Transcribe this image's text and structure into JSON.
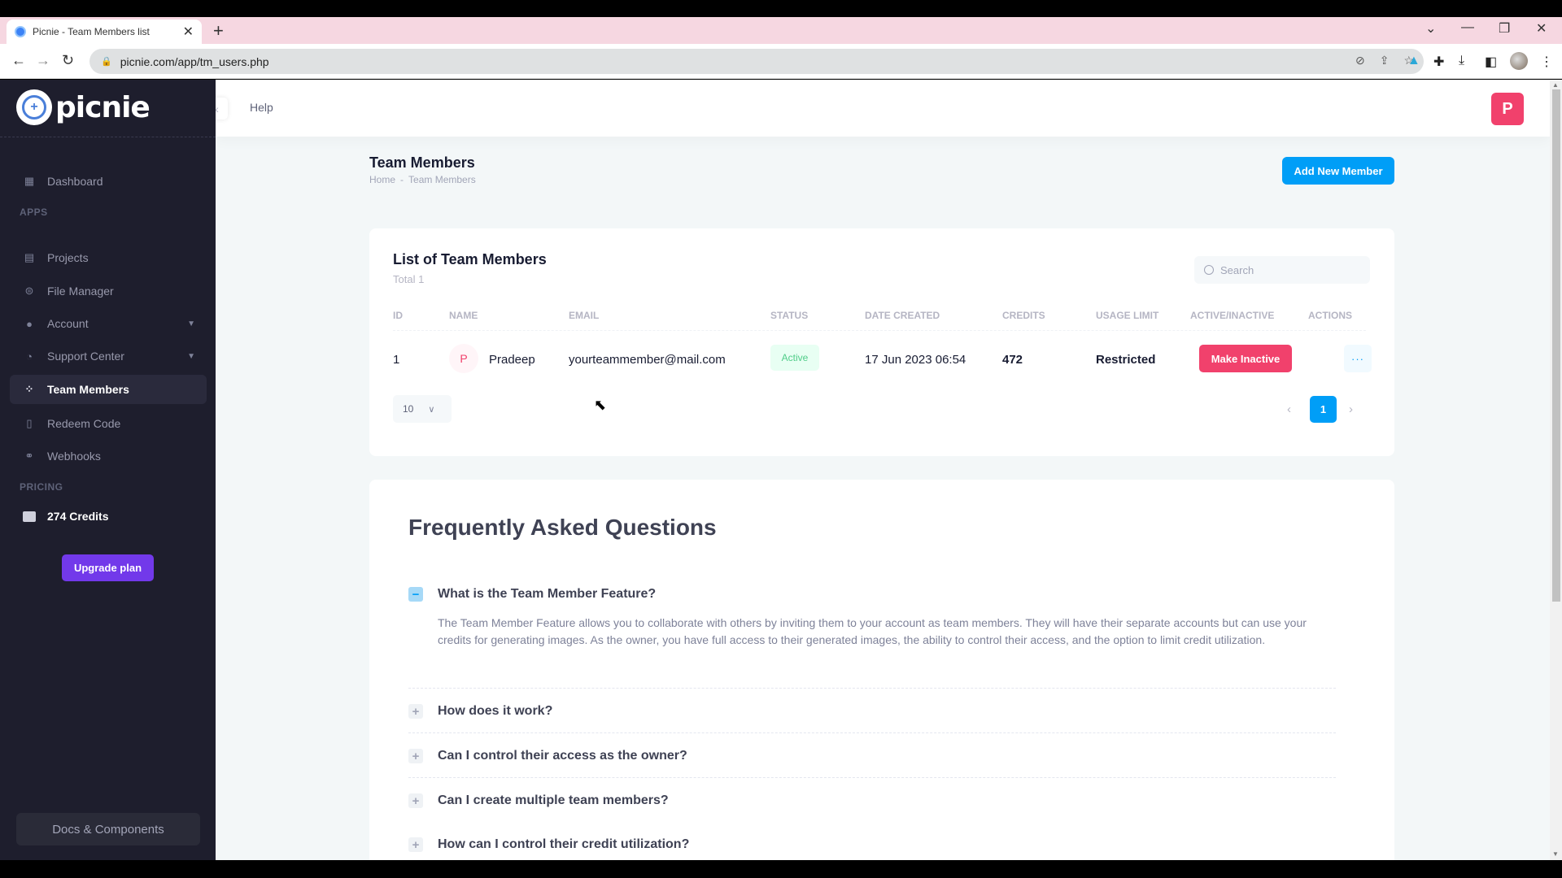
{
  "browser": {
    "tab_title": "Picnie - Team Members list",
    "url": "picnie.com/app/tm_users.php",
    "icons": [
      "back-icon",
      "forward-icon",
      "reload-icon",
      "lock-icon",
      "eye-off-icon",
      "share-icon",
      "star-icon",
      "extension-a-icon",
      "puzzle-icon",
      "download-icon",
      "sidepanel-icon",
      "profile-icon",
      "menu-icon"
    ]
  },
  "sidebar": {
    "logo_text": "picnie",
    "items_top": [
      {
        "label": "Dashboard",
        "icon": "dashboard-icon"
      }
    ],
    "section_apps": "APPS",
    "apps": [
      {
        "label": "Projects",
        "icon": "projects-icon",
        "has_chevron": false,
        "active": false
      },
      {
        "label": "File Manager",
        "icon": "toggle-icon",
        "has_chevron": false,
        "active": false
      },
      {
        "label": "Account",
        "icon": "user-icon",
        "has_chevron": true,
        "active": false
      },
      {
        "label": "Support Center",
        "icon": "support-icon",
        "has_chevron": true,
        "active": false
      },
      {
        "label": "Team Members",
        "icon": "team-icon",
        "has_chevron": false,
        "active": true
      },
      {
        "label": "Redeem Code",
        "icon": "map-icon",
        "has_chevron": false,
        "active": false
      },
      {
        "label": "Webhooks",
        "icon": "webhook-icon",
        "has_chevron": false,
        "active": false
      }
    ],
    "section_pricing": "PRICING",
    "credits_label": "274 Credits",
    "upgrade_label": "Upgrade plan",
    "docs_label": "Docs & Components"
  },
  "header": {
    "help_label": "Help",
    "avatar_initial": "P"
  },
  "page": {
    "title": "Team Members",
    "breadcrumb": [
      "Home",
      "-",
      "Team Members"
    ],
    "add_button": "Add New Member"
  },
  "list": {
    "title": "List of Team Members",
    "subtitle": "Total 1",
    "search_placeholder": "Search",
    "columns": [
      "ID",
      "NAME",
      "EMAIL",
      "STATUS",
      "DATE CREATED",
      "CREDITS",
      "USAGE LIMIT",
      "ACTIVE/INACTIVE",
      "ACTIONS"
    ],
    "rows": [
      {
        "id": "1",
        "initial": "P",
        "name": "Pradeep",
        "email": "yourteammember@mail.com",
        "status": "Active",
        "date_created": "17 Jun 2023 06:54",
        "credits": "472",
        "usage_limit": "Restricted",
        "toggle_label": "Make Inactive",
        "actions_label": "···"
      }
    ],
    "per_page": "10",
    "current_page": "1",
    "prev": "‹",
    "next": "›"
  },
  "faq": {
    "title": "Frequently Asked Questions",
    "items": [
      {
        "q": "What is the Team Member Feature?",
        "open": true,
        "a": "The Team Member Feature allows you to collaborate with others by inviting them to your account as team members. They will have their separate accounts but can use your credits for generating images. As the owner, you have full access to their generated images, the ability to control their access, and the option to limit credit utilization."
      },
      {
        "q": "How does it work?",
        "open": false
      },
      {
        "q": "Can I control their access as the owner?",
        "open": false
      },
      {
        "q": "Can I create multiple team members?",
        "open": false
      },
      {
        "q": "How can I control their credit utilization?",
        "open": false
      }
    ],
    "open_symbol": "−",
    "closed_symbol": "+"
  },
  "colors": {
    "sidebar_bg": "#1e1e2d",
    "primary": "#009ef7",
    "danger": "#f1416c",
    "success": "#50cd89",
    "upgrade": "#7239ea"
  }
}
